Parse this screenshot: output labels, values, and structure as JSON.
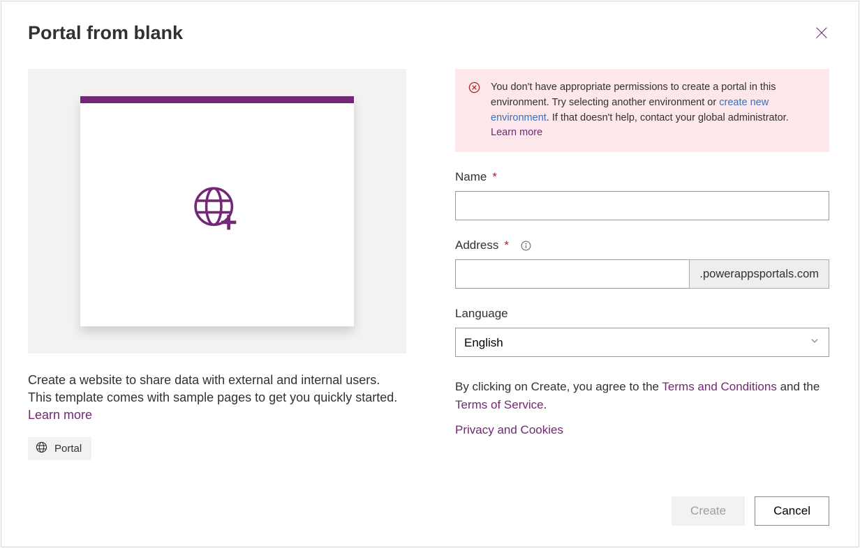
{
  "dialog": {
    "title": "Portal from blank"
  },
  "left": {
    "description": "Create a website to share data with external and internal users. This template comes with sample pages to get you quickly started. ",
    "description_link": "Learn more",
    "badge_label": "Portal"
  },
  "alert": {
    "text1": "You don't have appropriate permissions to create a portal in this environment. Try selecting another environment or ",
    "link1": "create new environment",
    "text2": ". If that doesn't help, contact your global administrator. ",
    "link2": "Learn more"
  },
  "form": {
    "name_label": "Name",
    "address_label": "Address",
    "address_suffix": ".powerappsportals.com",
    "language_label": "Language",
    "language_value": "English"
  },
  "legal": {
    "text1": "By clicking on Create, you agree to the ",
    "terms_link": "Terms and Conditions",
    "text2": " and the ",
    "tos_link": "Terms of Service",
    "text3": ".",
    "privacy_link": "Privacy and Cookies"
  },
  "footer": {
    "create_label": "Create",
    "cancel_label": "Cancel"
  }
}
